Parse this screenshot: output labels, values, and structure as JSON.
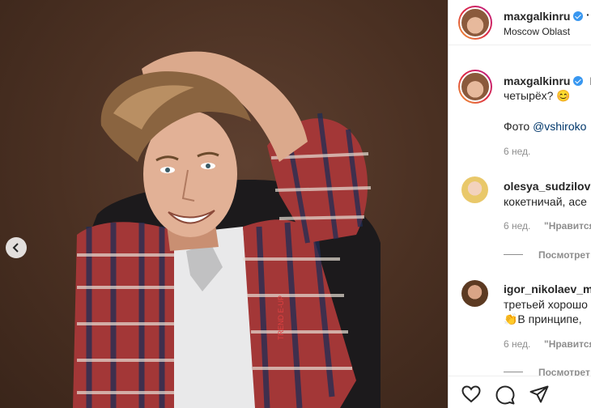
{
  "post": {
    "author": "maxgalkinru",
    "location": "Moscow Oblast",
    "caption_line1": "Н",
    "caption_line2": "четырёх? 😊",
    "photo_credit_prefix": "Фото ",
    "photo_credit_mention": "@vshiroko",
    "time": "6 нед."
  },
  "comments": [
    {
      "username": "olesya_sudzilovs",
      "text": "кокетничай, асе",
      "time": "6 нед.",
      "like_label": "\"Нравится",
      "view_replies": "Посмотрет"
    },
    {
      "username": "igor_nikolaev_m",
      "text_line1": "третьей хорошо",
      "text_line2": "👏В принципе,",
      "time": "6 нед.",
      "like_label": "\"Нравится",
      "view_replies": "Посмотрет"
    }
  ],
  "photo": {
    "shirt_text": "TREND E-UP"
  },
  "icons": {
    "prev": "chevron-left-icon",
    "like": "heart-icon",
    "comment": "comment-icon",
    "share": "paper-plane-icon",
    "verified": "verified-badge-icon"
  },
  "colors": {
    "accent": "#3897f0",
    "link": "#00376b",
    "secondary_text": "#8e8e8e",
    "background": "#6b4a37"
  }
}
